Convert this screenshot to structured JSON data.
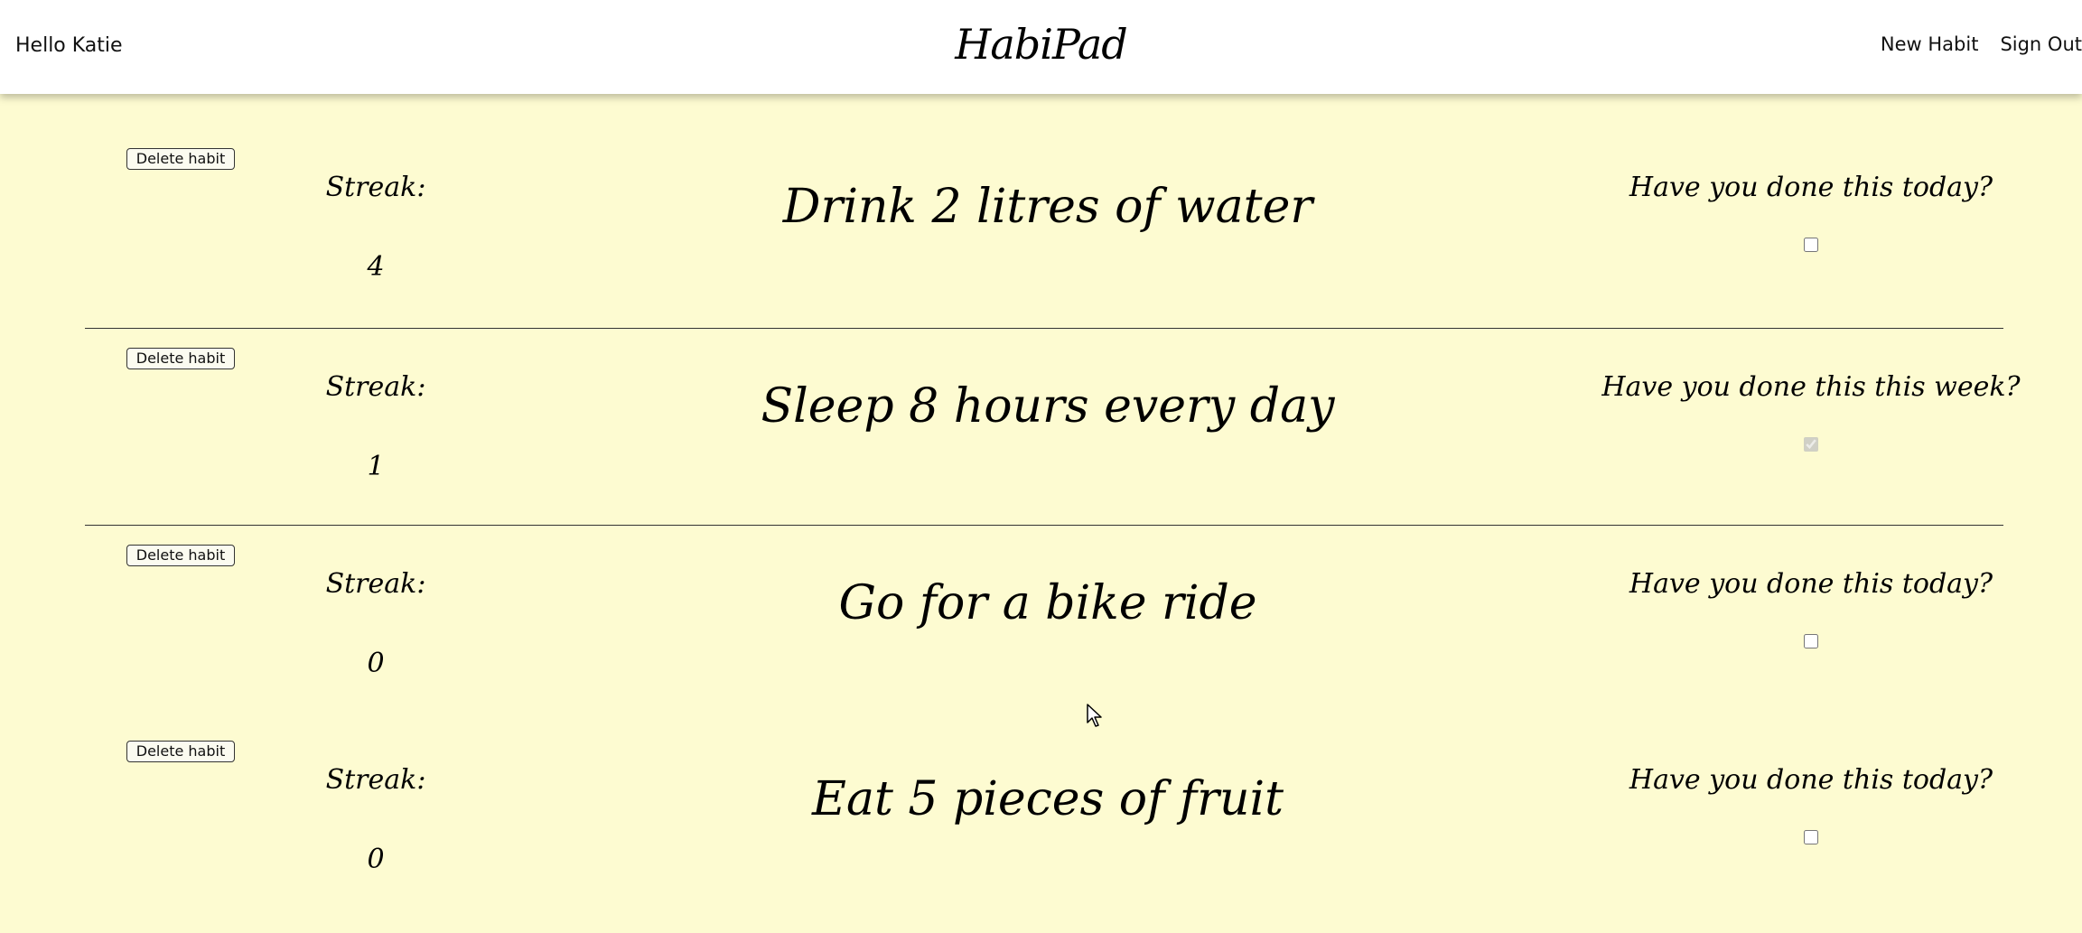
{
  "header": {
    "greeting": "Hello Katie",
    "brand": "HabiPad",
    "nav": {
      "new_habit": "New Habit",
      "sign_out": "Sign Out"
    }
  },
  "habits": [
    {
      "delete_label": "Delete habit",
      "streak_label": "Streak:",
      "streak": "4",
      "title": "Drink 2 litres of water",
      "question": "Have you done this today?",
      "done": false
    },
    {
      "delete_label": "Delete habit",
      "streak_label": "Streak:",
      "streak": "1",
      "title": "Sleep 8 hours every day",
      "question": "Have you done this this week?",
      "done": true,
      "disabled": true
    },
    {
      "delete_label": "Delete habit",
      "streak_label": "Streak:",
      "streak": "0",
      "title": "Go for a bike ride",
      "question": "Have you done this today?",
      "done": false
    },
    {
      "delete_label": "Delete habit",
      "streak_label": "Streak:",
      "streak": "0",
      "title": "Eat 5 pieces of fruit",
      "question": "Have you done this today?",
      "done": false
    }
  ],
  "colors": {
    "page_background": "#fdfbd1",
    "navbar_background": "#ffffff"
  }
}
